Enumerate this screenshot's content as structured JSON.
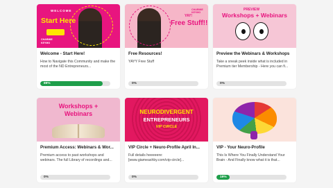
{
  "cards": [
    {
      "title": "Welcome - Start Here!",
      "description": "How to Navigate this Community and make the most of the ND Entrepreneurs...",
      "progress": 89,
      "progress_label": "89%",
      "thumb_text": {
        "top": "WELCOME",
        "main": "Start Here",
        "brand1": "CHARMIE",
        "brand2": "KEYMO"
      },
      "colors": {
        "bg": "#e8157f",
        "accent": "#ffe600"
      }
    },
    {
      "title": "Free Resources!",
      "description": "YAYY Free Stuff",
      "progress": 0,
      "progress_label": "0%",
      "thumb_text": {
        "top": "YAY!",
        "main": "Free Stuff!!",
        "brand1": "CHARMIE",
        "brand2": "KEYMO"
      },
      "colors": {
        "bg": "#f6b6c8",
        "accent": "#e8157f"
      }
    },
    {
      "title": "Preview the Webinars & Workshops",
      "description": "Take a sneak peek inside what is included in Premium tier Membership - Here you can fi...",
      "progress": 0,
      "progress_label": "0%",
      "thumb_text": {
        "top": "PREVIEW",
        "main": "Workshops + Webinars"
      },
      "colors": {
        "bg": "#f6c6d6",
        "accent": "#e8157f"
      }
    },
    {
      "title": "Premium Access: Webinars & Wor...",
      "description": "Premium access to past workshops and webinars. The full Library of recordings and...",
      "progress": 0,
      "progress_label": "0%",
      "thumb_text": {
        "main1": "Workshops +",
        "main2": "Webinars"
      },
      "colors": {
        "bg": "#f0b8cf",
        "accent": "#e8157f"
      }
    },
    {
      "title": "VIP Circle + Neuro-Profile April In...",
      "description": "Full details heeeeere: [www.giameashby.com/vip-circle]...",
      "progress": 0,
      "progress_label": "0%",
      "thumb_text": {
        "main1": "NEURODIVERGENT",
        "main2": "ENTREPRENEURS",
        "sub": "VIP CIRCLE"
      },
      "colors": {
        "bg": "#e21860",
        "accent": "#ffe600"
      }
    },
    {
      "title": "VIP - Your Neuro-Profile",
      "description": "This Is Where You Finally Understand Your Brain - And Finally know what it is that...",
      "progress": 19,
      "progress_label": "19%",
      "colors": {
        "bg": "#fbe3dc"
      }
    }
  ]
}
